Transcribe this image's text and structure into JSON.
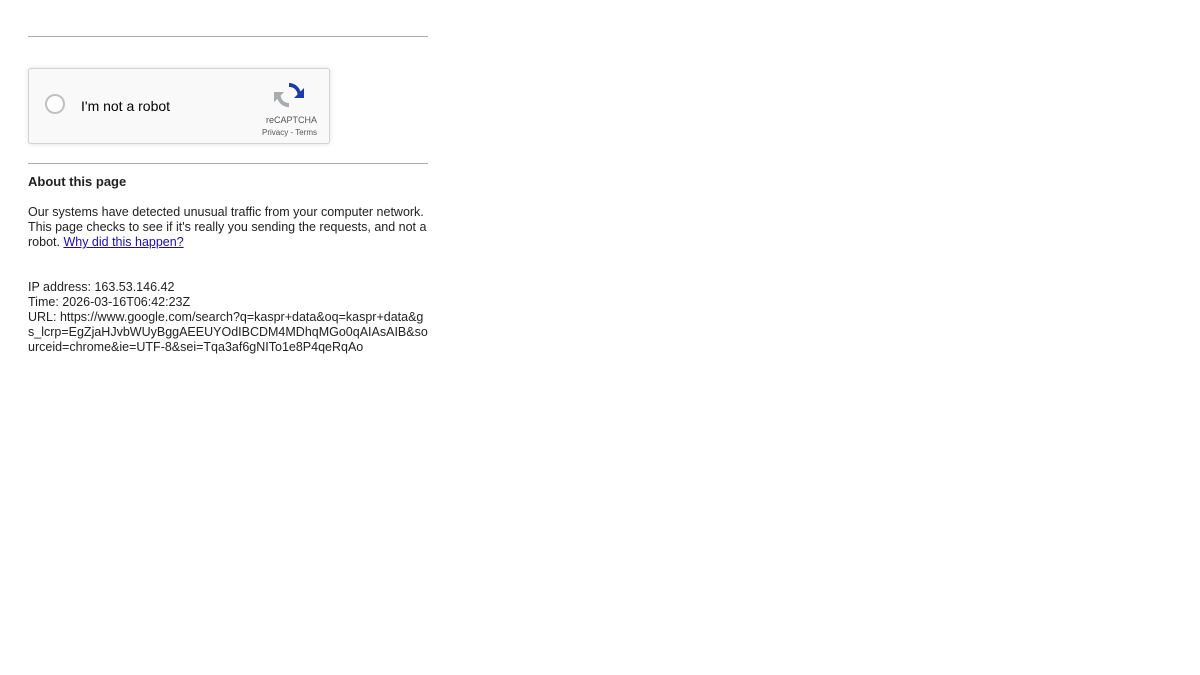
{
  "captcha": {
    "label": "I'm not a robot",
    "brand": "reCAPTCHA",
    "privacy_link": "Privacy",
    "separator": " - ",
    "terms_link": "Terms",
    "logo_icon": "recaptcha-logo-icon"
  },
  "about": {
    "title": "About this page",
    "text": "Our systems have detected unusual traffic from your computer network. This page checks to see if it's really you sending the requests, and not a robot. ",
    "link": "Why did this happen?"
  },
  "meta": {
    "ip": "IP address: 163.53.146.42",
    "time": "Time: 2026-03-16T06:42:23Z",
    "url": "URL: https://www.google.com/search?q=kaspr+data&oq=kaspr+data&gs_lcrp=EgZjaHJvbWUyBggAEEUYOdIBCDM4MDhqMGo0qAIAsAIB&sourceid=chrome&ie=UTF-8&sei=Tqa3af6gNITo1e8P4qeRqAo"
  },
  "colors": {
    "link": "#1a0dab",
    "rule": "#aaaaaa",
    "captcha_bg": "#f9f9f9",
    "recaptcha_blue": "#1c3aa9",
    "recaptcha_lightblue": "#4285f4",
    "recaptcha_gray": "#ababab"
  }
}
